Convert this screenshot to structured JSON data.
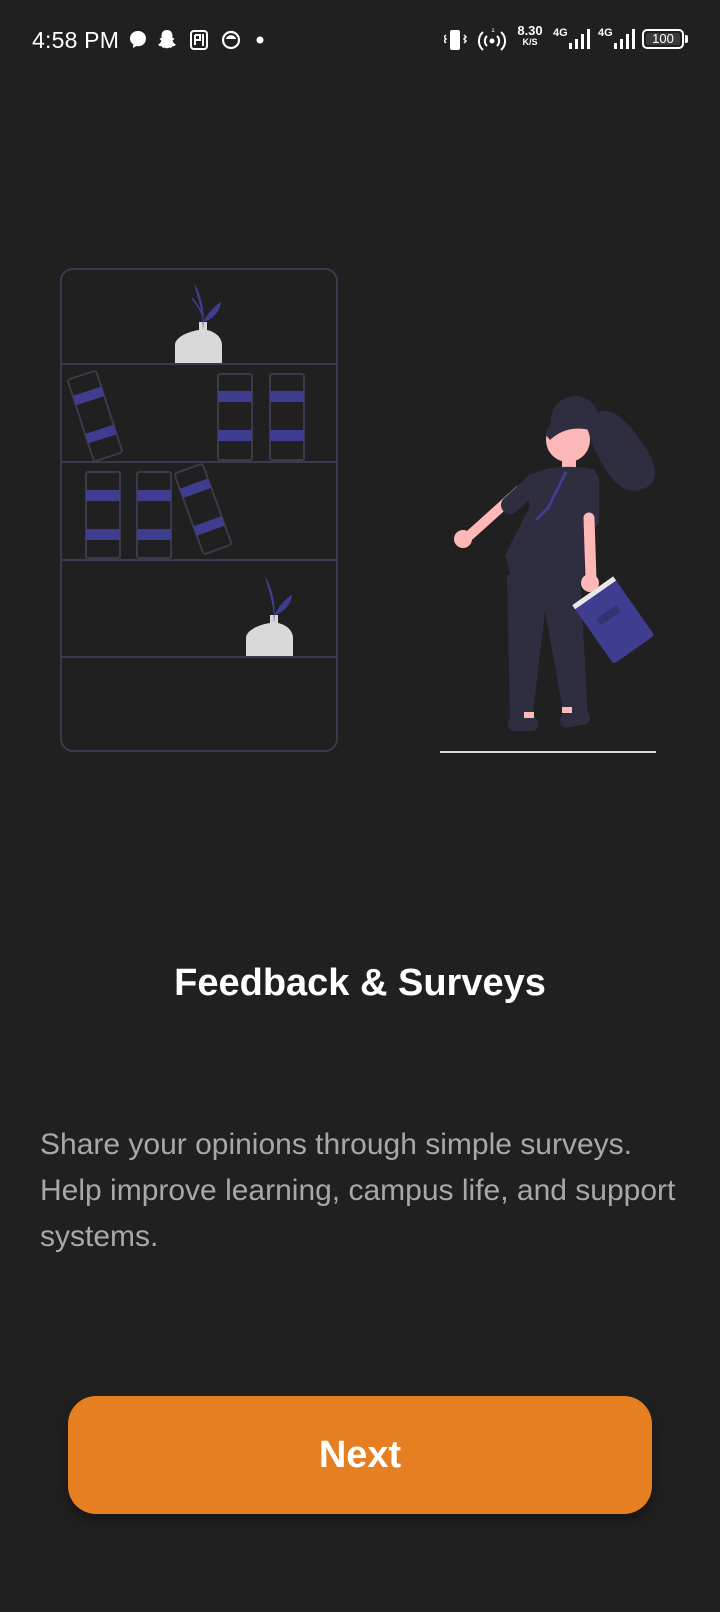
{
  "status_bar": {
    "time": "4:58 PM",
    "net_speed_value": "8.30",
    "net_speed_unit": "K/S",
    "signal1_label": "4G",
    "signal2_label": "4G",
    "battery_level": "100",
    "icons_left": [
      "messenger-icon",
      "snapchat-icon",
      "paytm-icon",
      "app-icon",
      "dot-icon"
    ],
    "icons_right": [
      "vibrate-icon",
      "hotspot-icon",
      "signal-icon",
      "signal-icon",
      "battery-icon"
    ]
  },
  "onboarding": {
    "title": "Feedback & Surveys",
    "description": "Share your opinions through simple surveys. Help improve learning, campus life, and support systems.",
    "next_label": "Next"
  },
  "colors": {
    "background": "#202020",
    "accent": "#e67e22",
    "illustration_purple": "#3f3d8f",
    "illustration_dark": "#2f2e41",
    "skin": "#ffb8b8"
  }
}
